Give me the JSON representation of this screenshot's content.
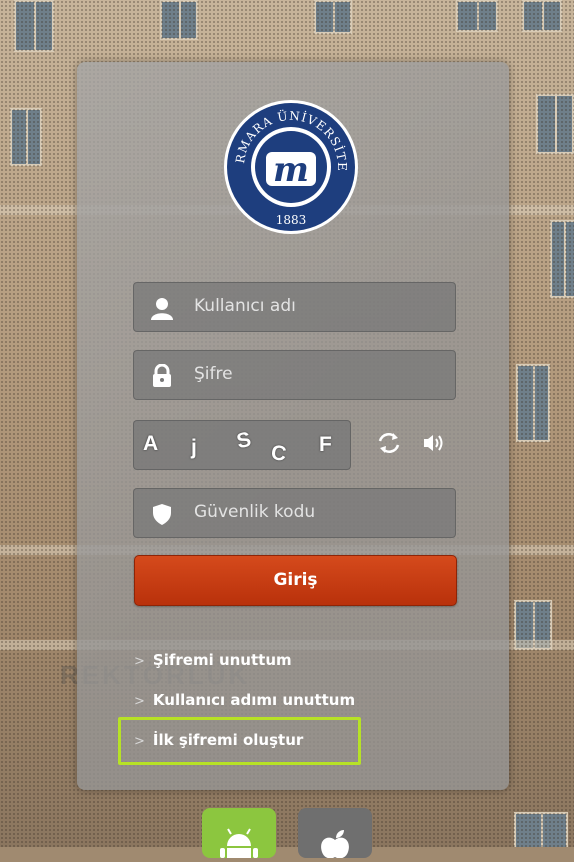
{
  "logo": {
    "text_top": "MARMARA ÜNİVERSİTESİ",
    "year": "1883",
    "monogram": "m"
  },
  "login": {
    "username_placeholder": "Kullanıcı adı",
    "password_placeholder": "Şifre",
    "captcha_chars": [
      "A",
      "j",
      "S",
      "C",
      "F"
    ],
    "security_code_placeholder": "Güvenlik kodu",
    "submit_label": "Giriş"
  },
  "links": {
    "forgot_password": "Şifremi unuttum",
    "forgot_username": "Kullanıcı adımı unuttum",
    "create_first_password": "İlk şifremi oluştur"
  },
  "colors": {
    "submit": "#c23a12",
    "highlight": "#b7e226",
    "android": "#8cc63f",
    "apple": "#6f6f6f"
  },
  "icons": {
    "username": "user-icon",
    "password": "lock-icon",
    "security": "shield-icon",
    "refresh": "refresh-icon",
    "audio": "speaker-icon",
    "android": "android-icon",
    "apple": "apple-icon"
  }
}
